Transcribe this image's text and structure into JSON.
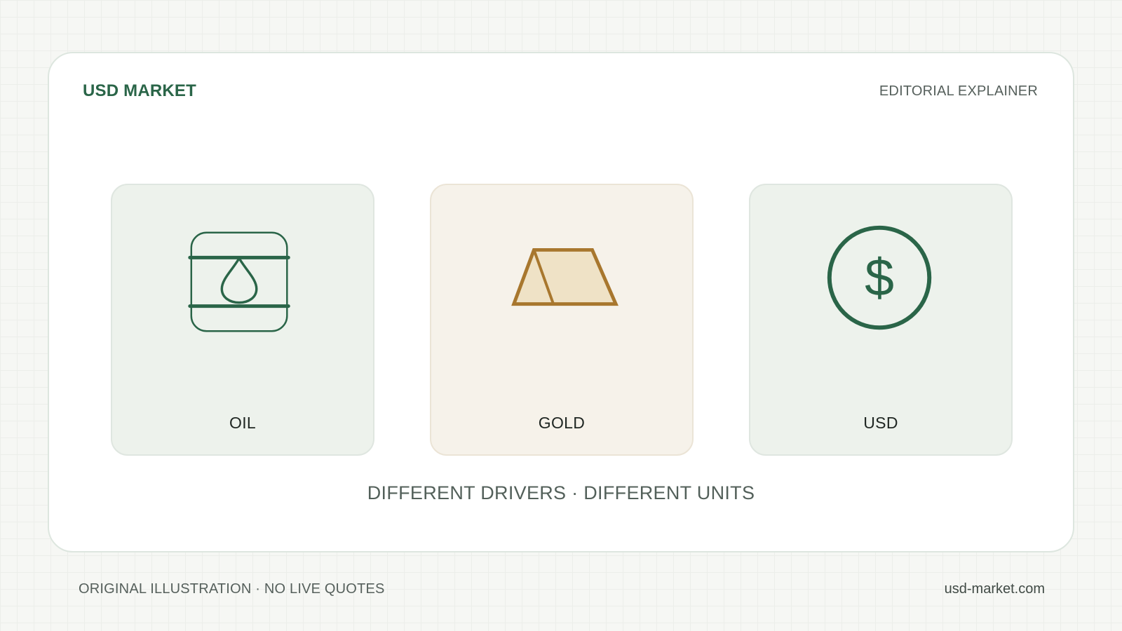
{
  "header": {
    "brand": "USD MARKET",
    "kicker": "EDITORIAL EXPLAINER"
  },
  "tiles": [
    {
      "label": "OIL",
      "icon": "oil-barrel-icon"
    },
    {
      "label": "GOLD",
      "icon": "gold-bar-icon"
    },
    {
      "label": "USD",
      "icon": "dollar-coin-icon",
      "glyph": "$"
    }
  ],
  "tagline": "DIFFERENT DRIVERS · DIFFERENT UNITS",
  "footer": {
    "note": "ORIGINAL ILLUSTRATION · NO LIVE QUOTES",
    "site": "usd-market.com"
  },
  "colors": {
    "brand_green": "#2a6548",
    "gold": "#a8772e",
    "gold_fill": "#efe2c6",
    "tile_green": "#edf2ec",
    "tile_sand": "#f6f2ea"
  }
}
